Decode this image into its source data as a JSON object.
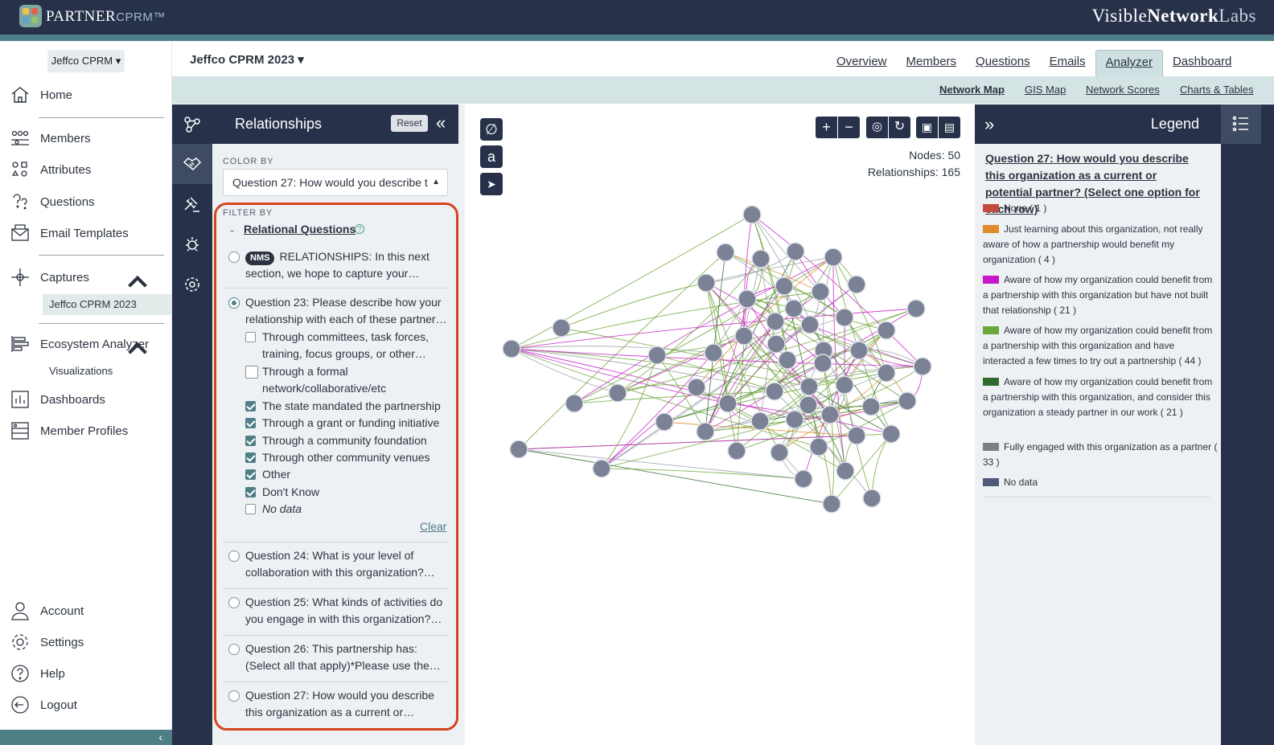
{
  "header": {
    "logo_partner": "PARTNER",
    "logo_cprm": "CPRM™",
    "brand_visible": "Visible",
    "brand_network": "Network",
    "brand_labs": "Labs"
  },
  "sidebar": {
    "workspace": "Jeffco CPRM ▾",
    "items": [
      {
        "label": "Home",
        "icon": "home-icon"
      },
      {
        "label": "Members",
        "icon": "members-icon"
      },
      {
        "label": "Attributes",
        "icon": "attributes-icon"
      },
      {
        "label": "Questions",
        "icon": "questions-icon"
      },
      {
        "label": "Email Templates",
        "icon": "email-templates-icon"
      },
      {
        "label": "Captures",
        "icon": "captures-icon"
      },
      {
        "label": "Ecosystem Analyzer",
        "icon": "ecosystem-analyzer-icon"
      },
      {
        "label": "Dashboards",
        "icon": "dashboards-icon"
      },
      {
        "label": "Member Profiles",
        "icon": "member-profiles-icon"
      },
      {
        "label": "Account",
        "icon": "account-icon"
      },
      {
        "label": "Settings",
        "icon": "settings-icon"
      },
      {
        "label": "Help",
        "icon": "help-icon"
      },
      {
        "label": "Logout",
        "icon": "logout-icon"
      }
    ],
    "captures_sub": "Jeffco CPRM 2023",
    "analyzer_sub": "Visualizations"
  },
  "project": {
    "title": "Jeffco CPRM 2023 ▾"
  },
  "main_tabs": [
    "Overview",
    "Members",
    "Questions",
    "Emails",
    "Analyzer",
    "Dashboard"
  ],
  "active_tab": "Analyzer",
  "sub_tabs": [
    "Network Map",
    "GIS Map",
    "Network Scores",
    "Charts & Tables"
  ],
  "active_sub_tab": "Network Map",
  "relationships": {
    "title": "Relationships",
    "reset": "Reset",
    "color_by_label": "COLOR BY",
    "color_by_value": "Question 27: How would you describe t",
    "filter_by_label": "FILTER BY",
    "group_title": "Relational Questions",
    "nms_badge": "NMS",
    "questions": [
      {
        "text": "RELATIONSHIPS: In this next section, we hope to capture your…",
        "selected": false
      },
      {
        "text": "Question 23: Please describe how your relationship with each of these partner…",
        "selected": true
      },
      {
        "text": "Question 24: What is your level of collaboration with this organization?…",
        "selected": false
      },
      {
        "text": "Question 25: What kinds of activities do you engage in with this organization?…",
        "selected": false
      },
      {
        "text": "Question 26: This partnership has: (Select all that apply)*Please use the…",
        "selected": false
      },
      {
        "text": "Question 27: How would you describe this organization as a current or…",
        "selected": false
      }
    ],
    "options": [
      {
        "label": "Through committees, task forces, training, focus groups, or other…",
        "checked": false
      },
      {
        "label": "Through a formal network/collaborative/etc",
        "checked": false
      },
      {
        "label": "The state mandated the partnership",
        "checked": true
      },
      {
        "label": "Through a grant or funding initiative",
        "checked": true
      },
      {
        "label": "Through a community foundation",
        "checked": true
      },
      {
        "label": "Through other community venues",
        "checked": true
      },
      {
        "label": "Other",
        "checked": true
      },
      {
        "label": "Don't Know",
        "checked": true
      },
      {
        "label": "No data",
        "checked": false
      }
    ],
    "clear": "Clear"
  },
  "network": {
    "nodes_label": "Nodes: 50",
    "relationships_label": "Relationships: 165",
    "node_color": "#7b8296",
    "edge_colors": [
      "#6da63a",
      "#c726c7",
      "#9aa0a8",
      "#2f6b2f",
      "#e08a2a"
    ]
  },
  "legend": {
    "title": "Legend",
    "question": "Question 27: How would you describe this organization as a current or potential partner? (Select one option for each row)",
    "items": [
      {
        "label": "None ( 1 )",
        "color": "#c24b3e"
      },
      {
        "label": "Just learning about this organization, not really aware of how a partnership would benefit my organization ( 4 )",
        "color": "#e08a2a"
      },
      {
        "label": "Aware of how my organization could benefit from a partnership with this organization but have not built that relationship ( 21 )",
        "color": "#c718c7"
      },
      {
        "label": "Aware of how my organization could benefit from a partnership with this organization and have interacted a few times to try out a partnership ( 44 )",
        "color": "#6da63a"
      },
      {
        "label": "Aware of how my organization could benefit from a partnership with this organization, and consider this organization a steady partner in our work ( 21 )",
        "color": "#2f6b2f"
      },
      {
        "label": "Fully engaged with this organization as a partner ( 33 )",
        "color": "#7f7f7f"
      },
      {
        "label": "No data",
        "color": "#4e5a78"
      }
    ]
  }
}
